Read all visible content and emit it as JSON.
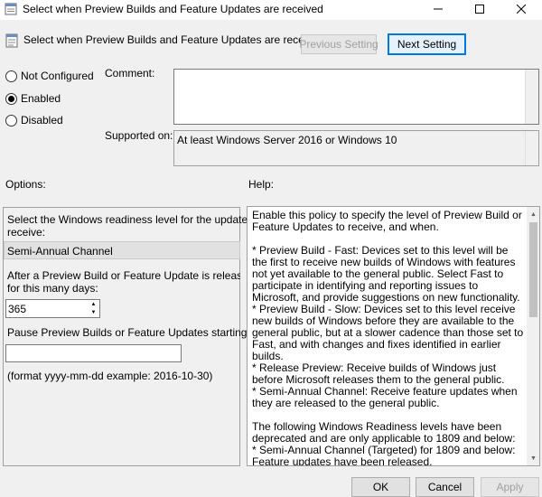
{
  "window": {
    "title": "Select when Preview Builds and Feature Updates are received",
    "icons": {
      "app": "policy-settings-icon",
      "minimize": "minimize-icon",
      "maximize": "maximize-icon",
      "close": "close-icon"
    }
  },
  "header": {
    "policy_title": "Select when Preview Builds and Feature Updates are received",
    "icon": "policy-settings-icon",
    "previous_label": "Previous Setting",
    "next_label": "Next Setting"
  },
  "state": {
    "options": [
      {
        "label": "Not Configured",
        "selected": false
      },
      {
        "label": "Enabled",
        "selected": true
      },
      {
        "label": "Disabled",
        "selected": false
      }
    ]
  },
  "comment": {
    "label": "Comment:",
    "value": ""
  },
  "supported": {
    "label": "Supported on:",
    "value": "At least Windows Server 2016 or Windows 10"
  },
  "options_section": {
    "title": "Options:",
    "readiness_prompt_line1": "Select the Windows readiness level for the updates you",
    "readiness_prompt_line2": "receive:",
    "readiness_value": "Semi-Annual Channel",
    "defer_prompt_line1": "After a Preview Build or Feature Update is released, defer",
    "defer_prompt_line2": "for this many days:",
    "defer_days": "365",
    "pause_prompt": "Pause Preview Builds or Feature Updates starting:",
    "pause_value": "",
    "format_hint": "(format yyyy-mm-dd example: 2016-10-30)"
  },
  "help": {
    "title": "Help:",
    "paragraphs": [
      "Enable this policy to specify the level of Preview Build or Feature Updates to receive, and when.",
      "",
      "* Preview Build - Fast: Devices set to this level will be the first to receive new builds of Windows with features not yet available to the general public. Select Fast to participate in identifying and reporting issues to Microsoft, and provide suggestions on new functionality.",
      "* Preview Build - Slow: Devices set to this level receive new builds of Windows before they are available to the general public, but at a slower cadence than those set to Fast, and with changes and fixes identified in earlier builds.",
      "* Release Preview: Receive builds of Windows just before Microsoft releases them to the general public.",
      "* Semi-Annual Channel: Receive feature updates when they are released to the general public.",
      "",
      "The following Windows Readiness levels have been deprecated and are only applicable to 1809 and below:",
      "* Semi-Annual Channel (Targeted) for 1809 and below: Feature updates have been released."
    ]
  },
  "footer": {
    "ok_label": "OK",
    "cancel_label": "Cancel",
    "apply_label": "Apply"
  }
}
